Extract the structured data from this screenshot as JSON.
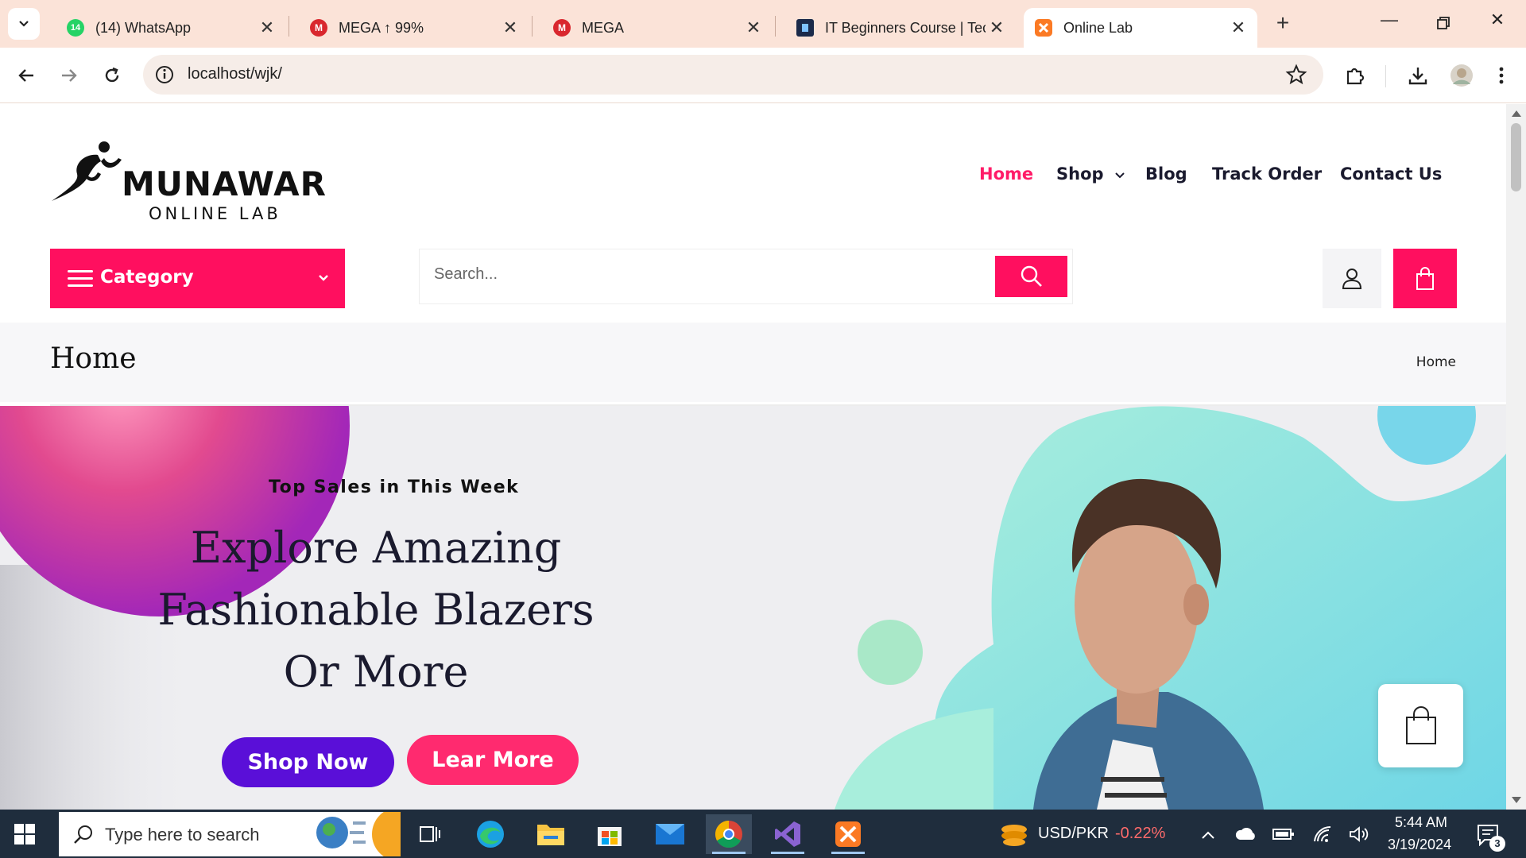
{
  "browser": {
    "tabs": [
      {
        "title": "(14) WhatsApp",
        "badge": "14",
        "icon": "whatsapp-icon",
        "color": "#25d366"
      },
      {
        "title": "MEGA ↑ 99%",
        "badge": "M",
        "icon": "mega-icon",
        "color": "#d9272e"
      },
      {
        "title": "MEGA",
        "badge": "M",
        "icon": "mega-icon",
        "color": "#d9272e"
      },
      {
        "title": "IT Beginners Course | Tec",
        "badge": "",
        "icon": "course-icon",
        "color": "#1b2a4a"
      },
      {
        "title": "Online Lab",
        "badge": "",
        "icon": "xampp-icon",
        "color": "#fb7a24"
      }
    ],
    "url": "localhost/wjk/"
  },
  "site": {
    "brand": "MUNAWAR",
    "brand_sub": "ONLINE LAB",
    "nav": [
      "Home",
      "Shop",
      "Blog",
      "Track Order",
      "Contact Us"
    ],
    "category_label": "Category",
    "search_placeholder": "Search...",
    "page_title": "Home",
    "breadcrumb": "Home",
    "colors": {
      "accent": "#ff0f5f",
      "purple": "#5a0fd8"
    }
  },
  "hero": {
    "subtitle": "Top Sales in This Week",
    "title_lines": [
      "Explore Amazing",
      "Fashionable Blazers",
      "Or More"
    ],
    "primary_button": "Shop Now",
    "secondary_button": "Lear More"
  },
  "taskbar": {
    "search_placeholder": "Type here to search",
    "currency": "USD/PKR",
    "change": "-0.22%",
    "time": "5:44 AM",
    "date": "3/19/2024",
    "notifications": "3"
  }
}
